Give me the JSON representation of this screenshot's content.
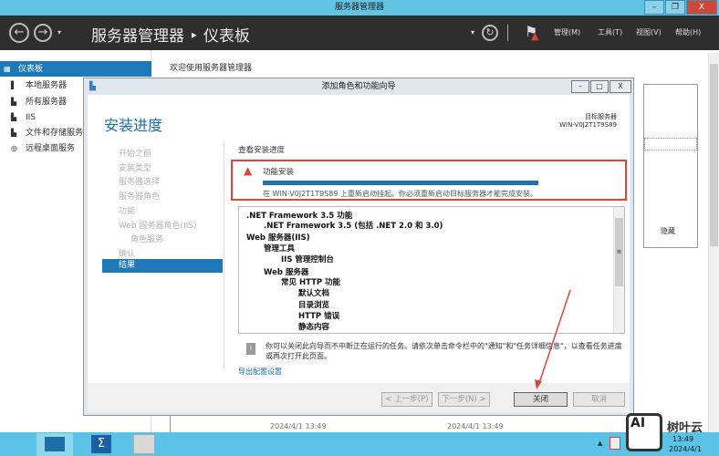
{
  "window": {
    "title": "服务器管理器",
    "min": "–",
    "restore": "❐",
    "close": "X"
  },
  "header": {
    "title": "服务器管理器 ‣ 仪表板",
    "menus": [
      "管理(M)",
      "工具(T)",
      "视图(V)",
      "帮助(H)"
    ]
  },
  "sidebar": {
    "items": [
      {
        "label": "仪表板",
        "icon": "▦"
      },
      {
        "label": "本地服务器",
        "icon": "▌"
      },
      {
        "label": "所有服务器",
        "icon": "▙"
      },
      {
        "label": "IIS",
        "icon": "▙"
      },
      {
        "label": "文件和存储服务",
        "icon": "▙"
      },
      {
        "label": "远程桌面服务",
        "icon": "◎"
      }
    ]
  },
  "main": {
    "welcome": "欢迎使用服务器管理器",
    "hide": "隐藏",
    "dates": [
      "2024/4/1 13:49",
      "2024/4/1 13:49"
    ]
  },
  "dialog": {
    "title": "添加角色和功能向导",
    "heading": "安装进度",
    "target_label": "目标服务器",
    "target_server": "WIN-V0J2T1T9S89",
    "steps": [
      "开始之前",
      "安装类型",
      "服务器选择",
      "服务器角色",
      "功能",
      "Web 服务器角色(IIS)",
      "角色服务",
      "确认",
      "结果"
    ],
    "section_title": "查看安装进度",
    "status_title": "功能安装",
    "progress": 1.0,
    "status_message": "在 WIN-V0J2T1T9S89 上重新启动挂起。你必须重新启动目标服务器才能完成安装。",
    "features": [
      ".NET Framework 3.5 功能",
      ".NET Framework 3.5 (包括 .NET 2.0 和 3.0)",
      "Web 服务器(IIS)",
      "管理工具",
      "IIS 管理控制台",
      "Web 服务器",
      "常见 HTTP 功能",
      "默认文档",
      "目录浏览",
      "HTTP 错误",
      "静态内容"
    ],
    "info": "你可以关闭此向导而不中断正在运行的任务。请依次单击命令栏中的\"通知\"和\"任务详细信息\"，以查看任务进度或再次打开此页面。",
    "export_link": "导出配置设置",
    "buttons": {
      "prev": "< 上一步(P)",
      "next": "下一步(N) >",
      "close": "关闭",
      "cancel": "取消"
    }
  },
  "taskbar": {
    "time": "13:49",
    "date": "2024/4/1"
  },
  "watermark": "树叶云",
  "colors": {
    "accent": "#1f78b7",
    "warning": "#d9473a",
    "titlebar": "#62c4e4"
  }
}
